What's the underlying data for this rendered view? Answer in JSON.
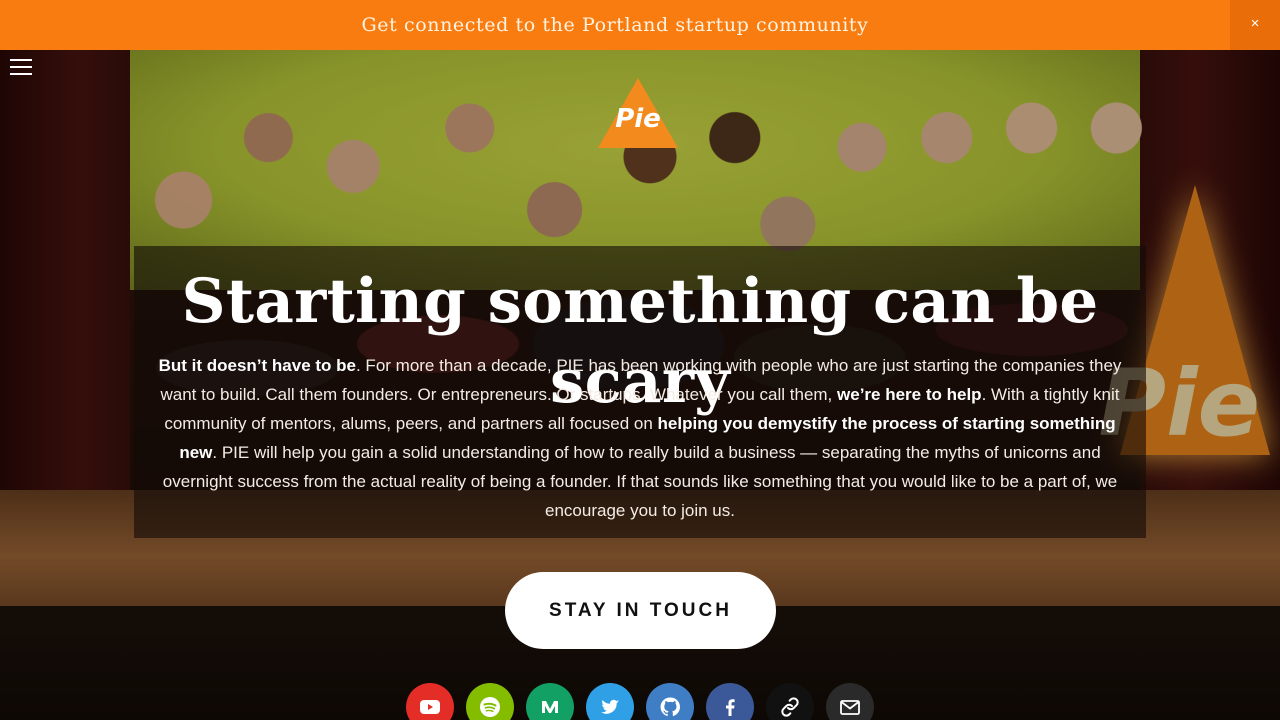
{
  "banner": {
    "text": "Get connected to the Portland startup community",
    "close_label": "×"
  },
  "logo": {
    "text": "Pie"
  },
  "hero": {
    "headline": "Starting something can be scary",
    "body": [
      {
        "text": "But it doesn’t have to be",
        "bold": true
      },
      {
        "text": ". For more than a decade, PIE has been working with people who are just starting the companies they want to build. Call them founders. Or entrepreneurs. Or startups. Whatever you call them, ",
        "bold": false
      },
      {
        "text": "we’re here to help",
        "bold": true
      },
      {
        "text": ". With a tightly knit community of mentors, alums, peers, and partners all focused on ",
        "bold": false
      },
      {
        "text": "helping you demystify the process of starting something new",
        "bold": true
      },
      {
        "text": ". PIE will help you gain a solid understanding of how to really build a business — separating the myths of unicorns and overnight success from the actual reality of being a founder. If that sounds like something that you would like to be a part of, we encourage you to join us.",
        "bold": false
      }
    ],
    "background_text": "Pie",
    "cta_label": "STAY IN TOUCH"
  },
  "social": [
    {
      "name": "youtube-icon",
      "color": "#e52d27"
    },
    {
      "name": "spotify-icon",
      "color": "#84bd00"
    },
    {
      "name": "medium-icon",
      "color": "#12a065"
    },
    {
      "name": "twitter-icon",
      "color": "#2fa0e6"
    },
    {
      "name": "github-icon",
      "color": "#3f7ec4"
    },
    {
      "name": "facebook-icon",
      "color": "#3b5998"
    },
    {
      "name": "link-icon",
      "color": "#111111"
    },
    {
      "name": "email-icon",
      "color": "#2a2a2a"
    }
  ],
  "colors": {
    "banner_bg": "#f97c10",
    "accent": "#f28a1d",
    "cta_bg": "#ffffff"
  }
}
